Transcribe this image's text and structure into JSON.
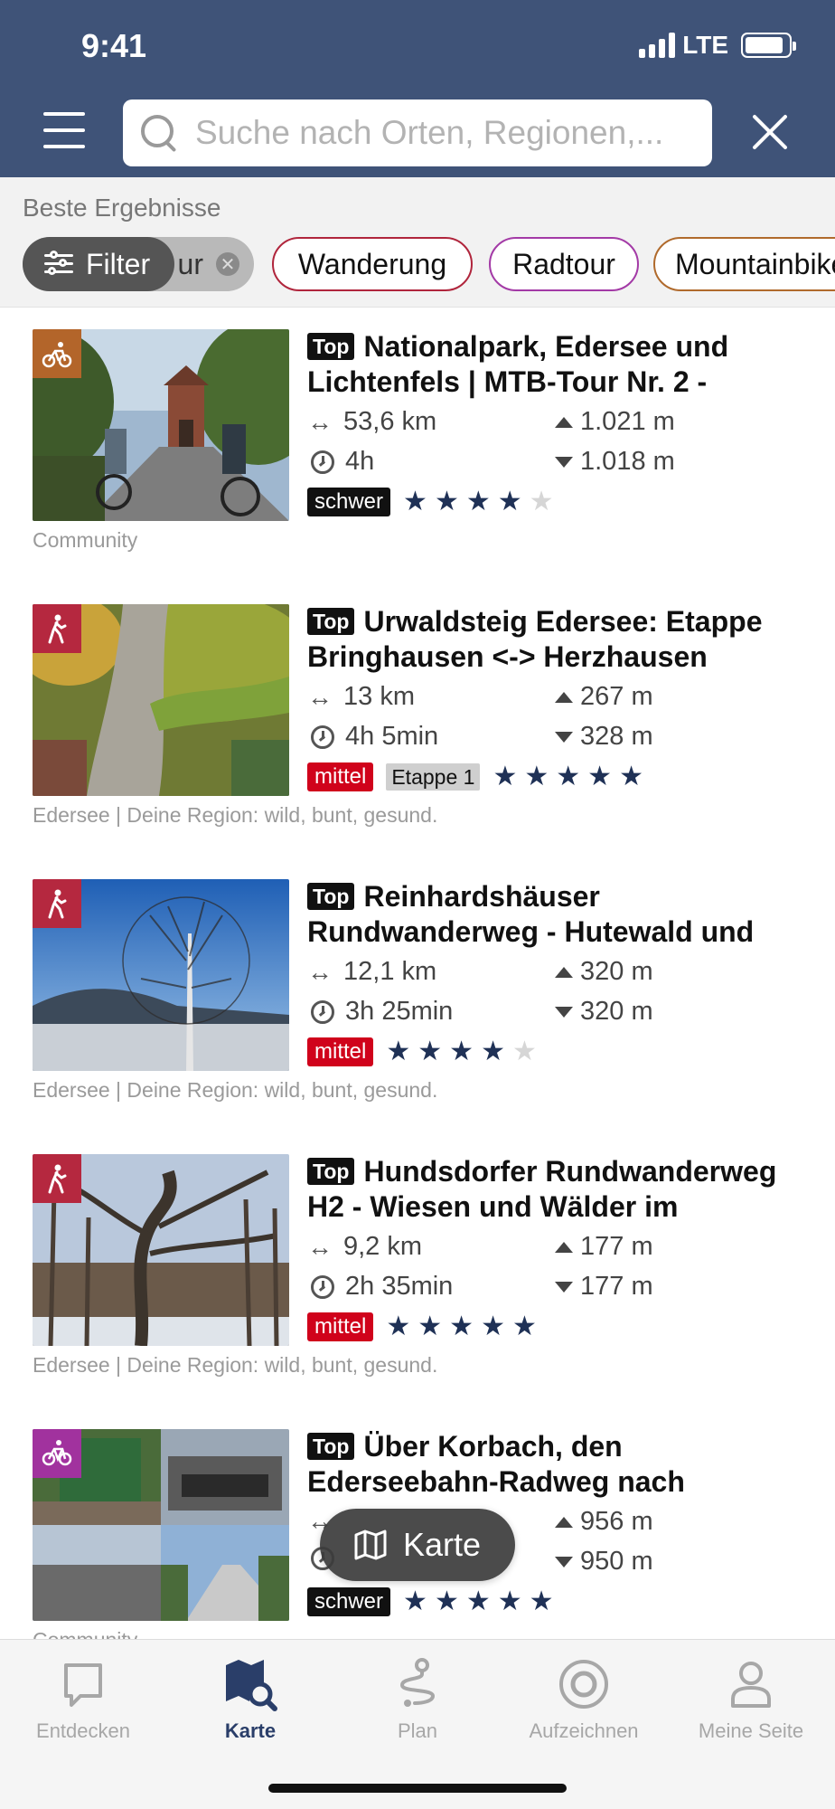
{
  "status_bar": {
    "time": "9:41",
    "network": "LTE"
  },
  "header": {
    "search_placeholder": "Suche nach Orten, Regionen,..."
  },
  "filters": {
    "section_label": "Beste Ergebnisse",
    "filter_button": "Filter",
    "active_chip_tail": "ur",
    "chips": [
      "Wanderung",
      "Radtour",
      "Mountainbike"
    ]
  },
  "tours": [
    {
      "type": "mtb",
      "top_label": "Top",
      "title": "Nationalpark, Edersee und Lichtenfels | MTB-Tour Nr. 2 -",
      "length": "53,6 km",
      "duration": "4h",
      "ascent": "1.021 m",
      "descent": "1.018 m",
      "difficulty": "schwer",
      "stage": null,
      "rating": 4,
      "source": "Community"
    },
    {
      "type": "hike",
      "top_label": "Top",
      "title": "Urwaldsteig Edersee: Etappe Bringhausen <-> Herzhausen",
      "length": "13 km",
      "duration": "4h 5min",
      "ascent": "267 m",
      "descent": "328 m",
      "difficulty": "mittel",
      "stage": "Etappe 1",
      "rating": 5,
      "source": "Edersee | Deine Region: wild, bunt, gesund."
    },
    {
      "type": "hike",
      "top_label": "Top",
      "title": "Reinhardshäuser Rundwanderweg - Hutewald und",
      "length": "12,1 km",
      "duration": "3h 25min",
      "ascent": "320 m",
      "descent": "320 m",
      "difficulty": "mittel",
      "stage": null,
      "rating": 4,
      "source": "Edersee | Deine Region: wild, bunt, gesund."
    },
    {
      "type": "hike",
      "top_label": "Top",
      "title": "Hundsdorfer Rundwanderweg H2 - Wiesen und Wälder im",
      "length": "9,2 km",
      "duration": "2h 35min",
      "ascent": "177 m",
      "descent": "177 m",
      "difficulty": "mittel",
      "stage": null,
      "rating": 5,
      "source": "Edersee | Deine Region: wild, bunt, gesund."
    },
    {
      "type": "bike",
      "top_label": "Top",
      "title": "Über Korbach, den Ederseebahn-Radweg nach",
      "length": "",
      "duration": "",
      "ascent": "956 m",
      "descent": "950 m",
      "difficulty": "schwer",
      "stage": null,
      "rating": 5,
      "source": "Community"
    }
  ],
  "map_button": {
    "label": "Karte"
  },
  "tabbar": {
    "active": "Karte",
    "tabs": [
      "Entdecken",
      "Karte",
      "Plan",
      "Aufzeichnen",
      "Meine Seite"
    ]
  },
  "colors": {
    "header": "#3f5378",
    "difficulty_schwer": "#111111",
    "difficulty_mittel": "#d0021b",
    "star": "#1f3156",
    "mtb_badge": "#b3652a",
    "hike_badge": "#b5283f",
    "bike_badge": "#a1329e",
    "active_tab": "#2a3e69"
  }
}
